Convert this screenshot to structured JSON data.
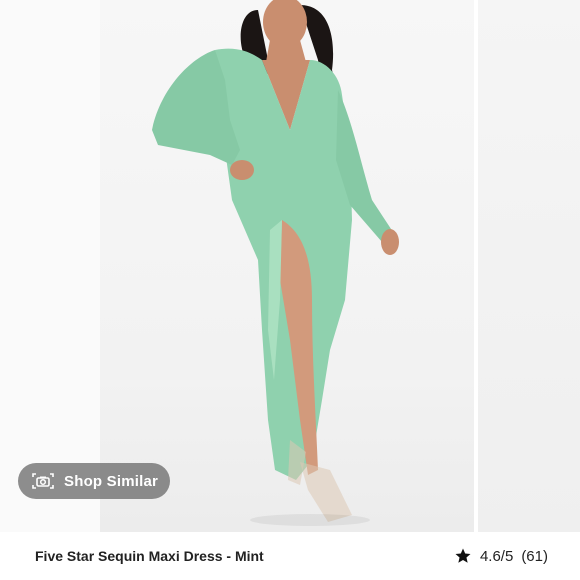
{
  "product": {
    "title": "Five Star Sequin Maxi Dress - Mint",
    "rating_text": "4.6/5",
    "review_count_text": "(61)",
    "rating_value": 4.6,
    "rating_max": 5
  },
  "actions": {
    "shop_similar_label": "Shop Similar"
  },
  "icons": {
    "camera": "camera-icon",
    "star": "star-icon"
  },
  "colors": {
    "dress": "#8fd1ae",
    "badge_bg": "#6e6e6e",
    "text": "#222222"
  }
}
